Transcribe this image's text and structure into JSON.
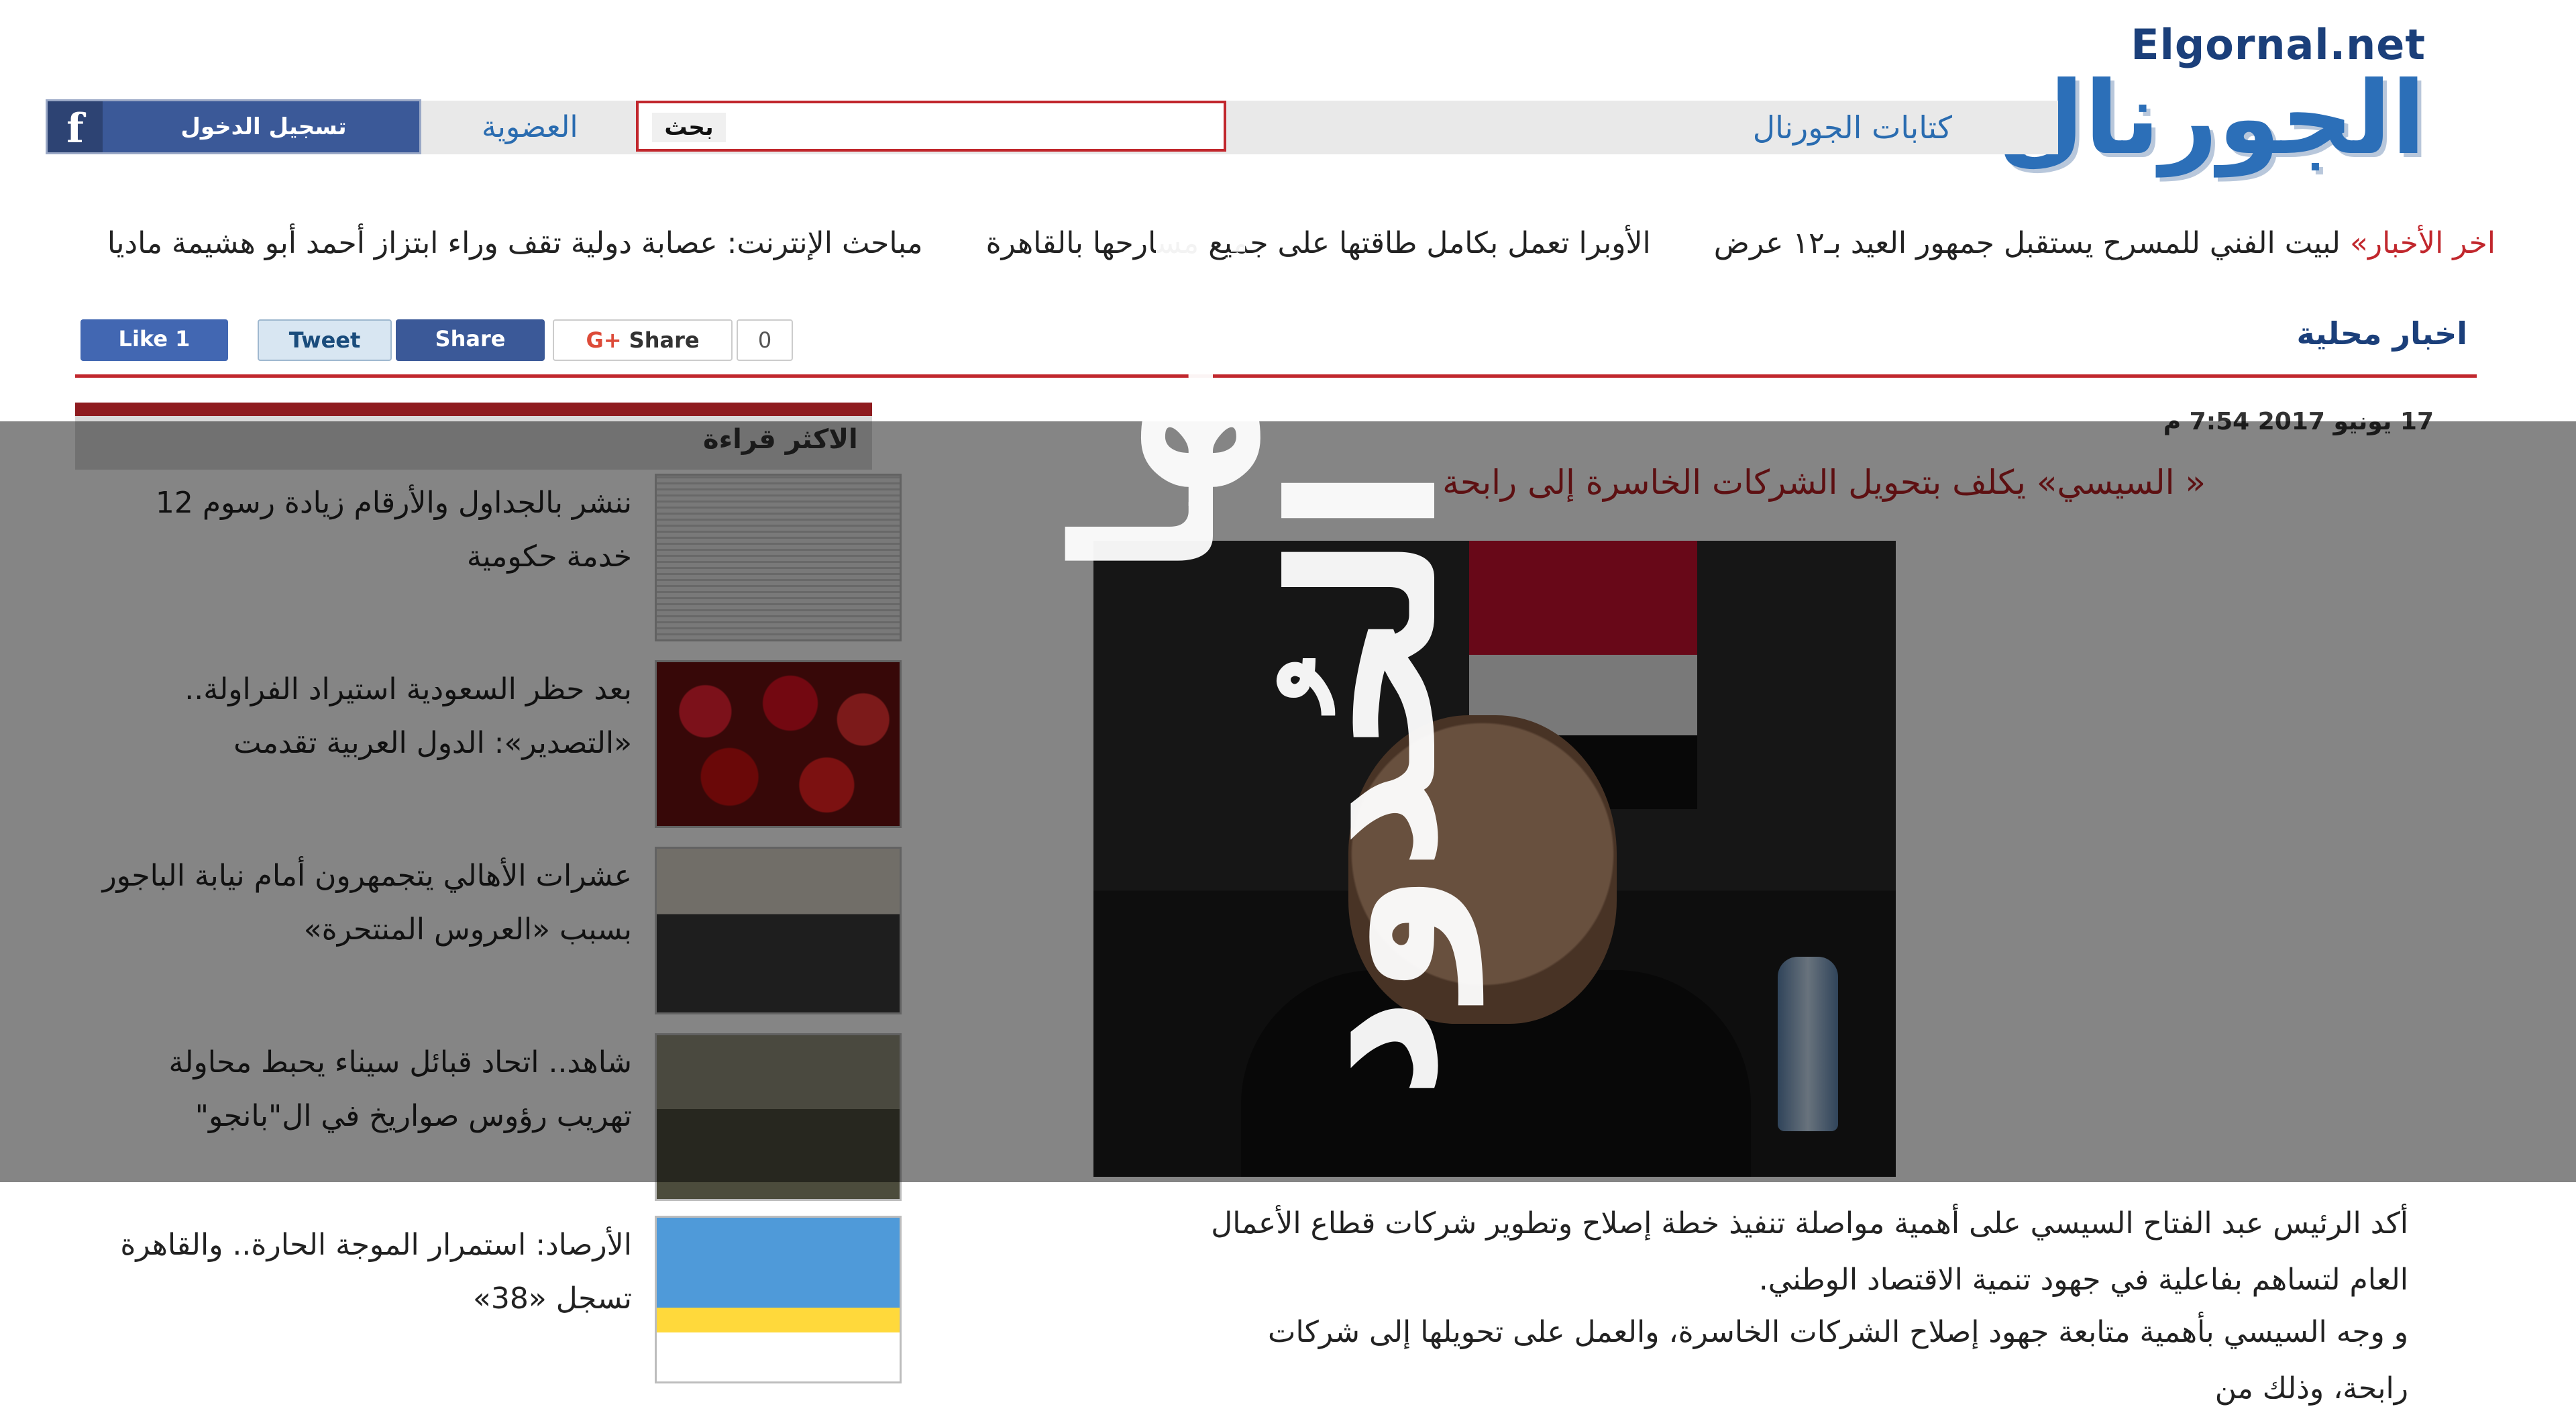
{
  "site": {
    "logo_url_text": "Elgornal.net",
    "logo_arabic": "الجورنال"
  },
  "header": {
    "kitabat_label": "كتابات الجورنال",
    "search_button": "بحث",
    "search_value": "",
    "membership_label": "العضوية",
    "fb_login_label": "تسجيل الدخول"
  },
  "ticker": {
    "lead": "اخر الأخبار»",
    "items": [
      "لبيت الفني للمسرح يستقبل جمهور العيد بـ١٢ عرض",
      "الأوبرا تعمل بكامل طاقتها على جميع مسارحها بالقاهرة",
      "مباحث الإنترنت: عصابة دولية تقف وراء ابتزاز أحمد أبو هشيمة ماديا"
    ]
  },
  "section": {
    "title": "اخبار محلية"
  },
  "share": {
    "like": "Like 1",
    "tweet": "Tweet",
    "fb_share": "Share",
    "g_share": "Share",
    "g_count": "0"
  },
  "sidebar": {
    "title": "الاكثر قراءة",
    "items": [
      {
        "title": "ننشر بالجداول والأرقام زيادة رسوم 12 خدمة حكومية"
      },
      {
        "title": "بعد حظر السعودية استيراد الفراولة.. «التصدير»: الدول العربية تقدمت"
      },
      {
        "title": "عشرات الأهالي يتجمهرون أمام نيابة الباجور بسبب «العروس المنتحرة»"
      },
      {
        "title": "شاهد.. اتحاد قبائل سيناء يحبط محاولة تهريب رؤوس صواريخ في ال\"بانجو\""
      },
      {
        "title": "الأرصاد: استمرار الموجة الحارة.. والقاهرة تسجل «38»"
      }
    ]
  },
  "article": {
    "date": "17 يونيو 2017 7:54 م",
    "headline": "« السيسي» يكلف بتحويل الشركات الخاسرة إلى رابحة",
    "paragraph1": "أكد الرئيس عبد الفتاح السيسي على أهمية مواصلة تنفيذ خطة إصلاح وتطوير شركات قطاع الأعمال العام لتساهم بفاعلية في جهود تنمية الاقتصاد الوطني.",
    "paragraph2": "و وجه السيسي بأهمية متابعة جهود إصلاح الشركات الخاسرة، والعمل على تحويلها إلى شركات رابحة، وذلك من"
  },
  "overlay": {
    "line1": "# ليتها",
    "line2": "الحُدود"
  }
}
